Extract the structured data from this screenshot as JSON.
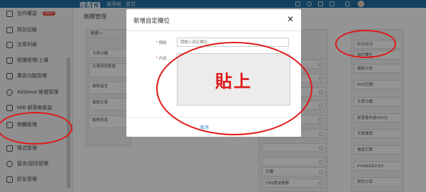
{
  "topbar": {
    "logo_text": "痞客",
    "logo_mark": "邦",
    "nav": [
      "部落格",
      "首頁"
    ]
  },
  "sidebar": {
    "items": [
      {
        "label": "合作權益",
        "badge": "NEW"
      },
      {
        "label": "拜訪記錄"
      },
      {
        "label": "文章列表"
      },
      {
        "label": "相簿管理/上傳"
      },
      {
        "label": "廣告功能管理"
      },
      {
        "label": "AdSense 帳號管理"
      },
      {
        "label": "MIB 部落格收益"
      },
      {
        "label": "側欄管理"
      },
      {
        "label": "樣式管理"
      },
      {
        "label": "留言/迴訊管理"
      },
      {
        "label": "好友管理"
      }
    ]
  },
  "main": {
    "title": "側欄管理",
    "column1": {
      "header": "側欄一",
      "widgets": [
        "文章分類",
        "大事調查數據",
        "最新留言",
        "最新文章",
        "動態訊息"
      ]
    },
    "column3": {
      "widgets": [
        "[Mobile]",
        "",
        "",
        "",
        "",
        "",
        "",
        "",
        "月曆",
        "CSS語法簡易",
        "相簿展示"
      ]
    },
    "column4": {
      "widgets": [
        "新增選項",
        "自訂欄位",
        "最新公告",
        "RSS訂閱",
        "文章分類",
        "部落客內容(RSS)",
        "文章搜尋",
        "搜尋引擎",
        "POWERED BY",
        "我的分享"
      ]
    }
  },
  "modal": {
    "title": "新增自定欄位",
    "close_label": "✕",
    "title_label": "標題",
    "title_placeholder": "請輸入自定欄位",
    "content_label": "內容",
    "content_value": "貼上",
    "cancel_label": "取消"
  }
}
